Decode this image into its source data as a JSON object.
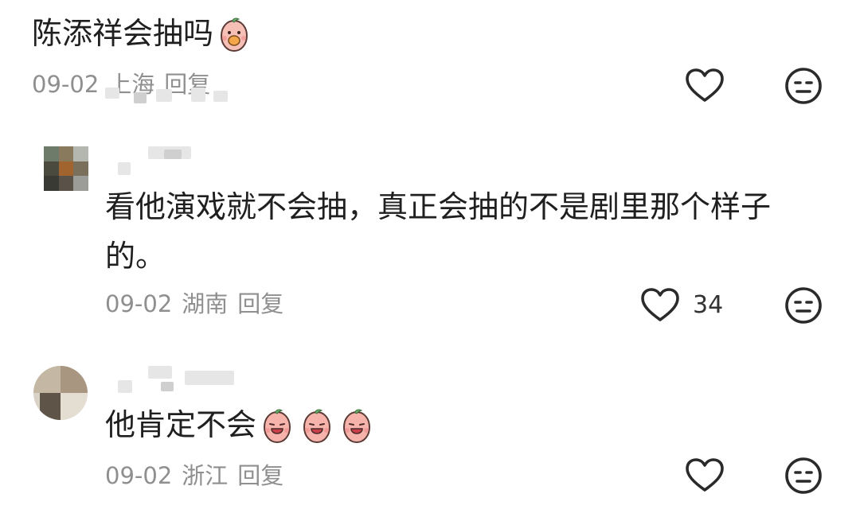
{
  "comments": [
    {
      "text": "陈添祥会抽吗",
      "date": "09-02",
      "location": "上海",
      "reply_label": "回复",
      "emoji": [
        "peach-eating-emoji"
      ]
    },
    {
      "text_line1": "看他演戏就不会抽，真正会抽的不是剧里那个样子",
      "text_line2": "的。",
      "date": "09-02",
      "location": "湖南",
      "reply_label": "回复",
      "like_count": "34"
    },
    {
      "text": "他肯定不会",
      "date": "09-02",
      "location": "浙江",
      "reply_label": "回复",
      "emoji": [
        "peach-crying-emoji",
        "peach-crying-emoji",
        "peach-crying-emoji"
      ]
    }
  ],
  "icons": {
    "like": "heart-outline-icon",
    "dislike": "meh-face-icon"
  },
  "colors": {
    "text": "#1f1f1f",
    "meta": "#8f8f8f",
    "icon": "#2a2a2a"
  }
}
